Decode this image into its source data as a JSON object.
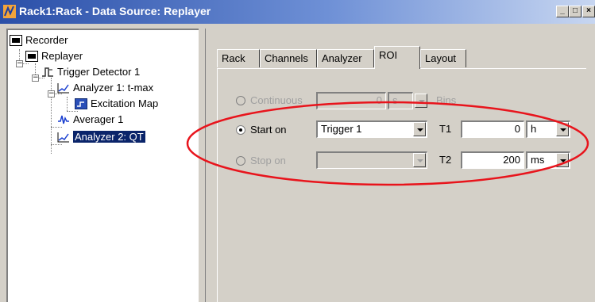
{
  "window": {
    "title": "Rack1:Rack - Data Source: Replayer",
    "minimize_glyph": "_",
    "maximize_glyph": "□",
    "close_glyph": "×"
  },
  "tree": {
    "items": [
      {
        "label": "Recorder",
        "icon": "recorder-icon"
      },
      {
        "label": "Replayer",
        "icon": "replayer-icon"
      },
      {
        "label": "Trigger Detector 1",
        "icon": "trigger-detector-icon"
      },
      {
        "label": "Analyzer 1: t-max",
        "icon": "analyzer-icon"
      },
      {
        "label": "Excitation Map",
        "icon": "excitation-map-icon"
      },
      {
        "label": "Averager 1",
        "icon": "averager-icon"
      },
      {
        "label": "Analyzer 2: QT",
        "icon": "analyzer-icon",
        "selected": true
      }
    ],
    "expander_glyph": "−"
  },
  "tabs": [
    {
      "label": "Rack"
    },
    {
      "label": "Channels"
    },
    {
      "label": "Analyzer"
    },
    {
      "label": "ROI",
      "active": true
    },
    {
      "label": "Layout"
    }
  ],
  "roi": {
    "continuous": {
      "label": "Continuous",
      "value": "0",
      "unit": "s",
      "suffix": "Bins",
      "enabled": false
    },
    "start_on": {
      "label": "Start on",
      "trigger": "Trigger 1",
      "t_label": "T1",
      "t_value": "0",
      "t_unit": "h",
      "checked": true
    },
    "stop_on": {
      "label": "Stop on",
      "trigger": "",
      "t_label": "T2",
      "t_value": "200",
      "t_unit": "ms",
      "enabled": false
    }
  },
  "annotation": {
    "color": "#e8141c"
  }
}
